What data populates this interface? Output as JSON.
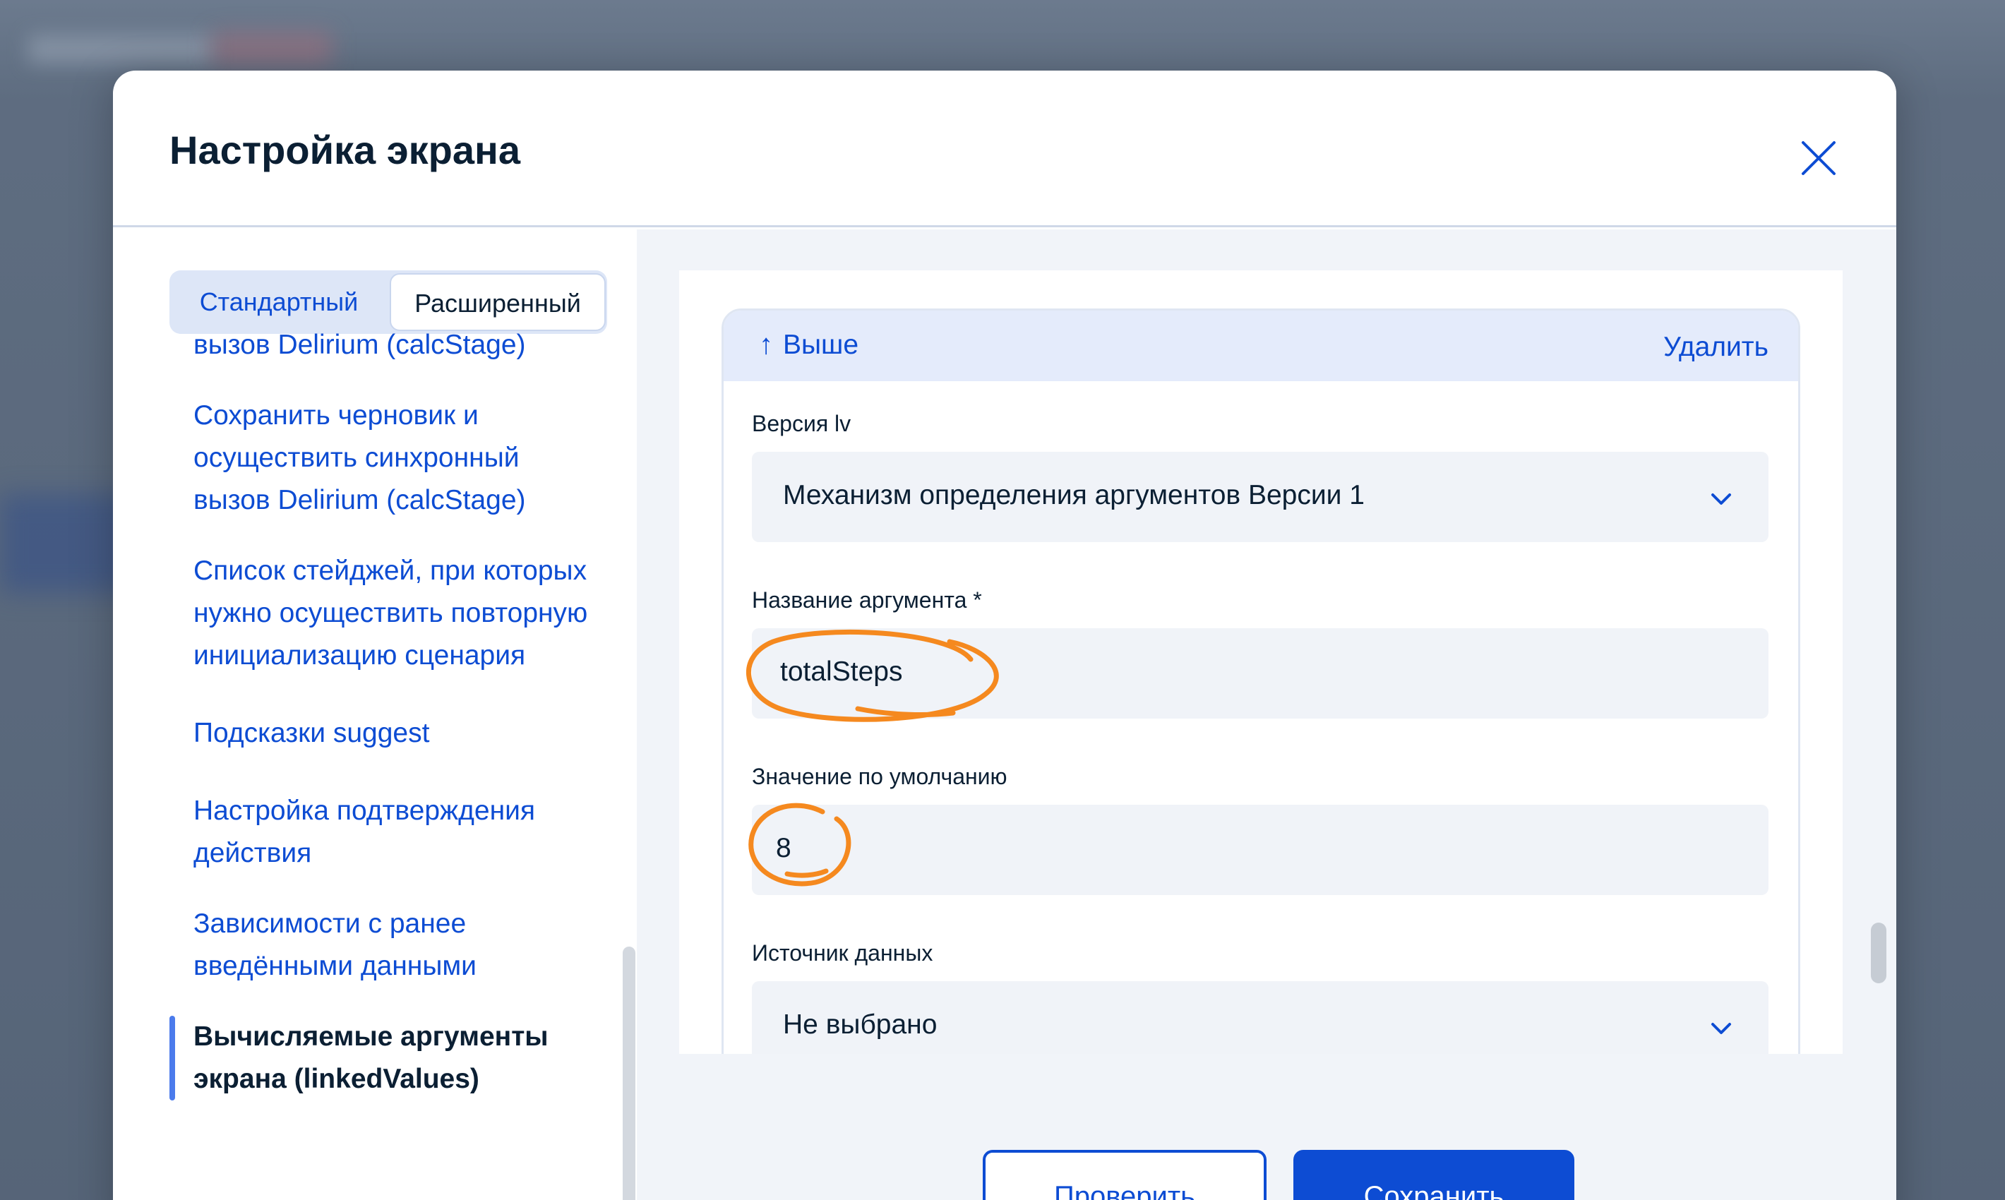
{
  "modal": {
    "title": "Настройка экрана"
  },
  "mode_switch": {
    "standard": "Стандартный",
    "advanced": "Расширенный",
    "selected": "advanced"
  },
  "sidebar": {
    "items": [
      {
        "label": "вызов Delirium (calcStage)"
      },
      {
        "label": "Сохранить черновик и осуществить синхронный вызов Delirium (calcStage)"
      },
      {
        "label": "Список стейджей, при которых нужно осуществить повторную инициализацию сценария"
      },
      {
        "label": "Подсказки suggest"
      },
      {
        "label": "Настройка подтверждения действия"
      },
      {
        "label": "Зависимости с ранее введёнными данными"
      },
      {
        "label": "Вычисляемые аргументы экрана (linkedValues)",
        "active": true
      }
    ]
  },
  "card": {
    "move_up": "Выше",
    "delete": "Удалить",
    "fields": {
      "version": {
        "label": "Версия lv",
        "value": "Механизм определения аргументов Версии 1"
      },
      "arg_name": {
        "label": "Название аргумента *",
        "value": "totalSteps"
      },
      "default_value": {
        "label": "Значение по умолчанию",
        "value": "8"
      },
      "data_source": {
        "label": "Источник данных",
        "value": "Не выбрано"
      }
    }
  },
  "footer": {
    "check": "Проверить",
    "save": "Сохранить"
  },
  "colors": {
    "primary": "#0d4cd3",
    "annotation": "#f5891f",
    "text": "#0b1f33"
  },
  "icons": {
    "close": "close-icon",
    "arrow_up": "arrow-up-icon",
    "chevron": "chevron-down-icon"
  }
}
